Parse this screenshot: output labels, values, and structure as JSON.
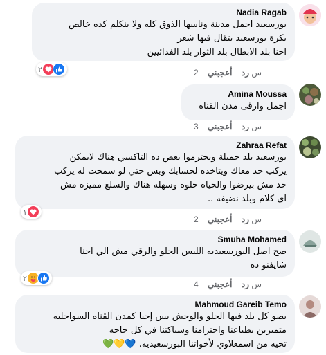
{
  "colors": {
    "bubble": "#f0f2f5",
    "like": "#1877f2",
    "love": "#f33e58",
    "care": "#f7b125",
    "meta": "#65676b"
  },
  "comments": [
    {
      "author": "Nadia Ragab",
      "lines": [
        "بورسعيد اجمل مدينة وناسها الذوق كله ولا بنكلم كده خالص",
        "بكرة بورسعيد يتقال فيها شعر",
        "احنا بلد الابطال بلد الثوار بلد الفدائيين"
      ],
      "like": "أعجبني",
      "reply": "رد",
      "time": "2 س",
      "reaction_count": "٢",
      "reactions": [
        "like-icon",
        "love-icon"
      ]
    },
    {
      "author": "Amina Moussa",
      "lines": [
        "اجمل وارقى مدن القناه"
      ],
      "like": "أعجبني",
      "reply": "رد",
      "time": "3 س"
    },
    {
      "author": "Zahraa Refat",
      "lines": [
        "بورسعيد بلد جميلة ويحترموا بعض ده التاكسي هناك لايمكن",
        "يركب حد معاك ويتاخده لحسابك وبس حتي لو سمحت له يركب",
        "حد مش بيرضوا والحياة حلوة وسهله هناك والسلع مميزة مش",
        "اي كلام وبلد نضيفه .."
      ],
      "like": "أعجبني",
      "reply": "رد",
      "time": "2 س",
      "reaction_count": "١",
      "reactions": [
        "love-icon"
      ]
    },
    {
      "author": "Smuha Mohamed",
      "lines": [
        "صح اصل البورسعيديه اللبس الحلو والرقي مش الي احنا",
        "شايفنو ده"
      ],
      "like": "أعجبني",
      "reply": "رد",
      "time": "4 س",
      "reaction_count": "٢",
      "reactions": [
        "like-icon",
        "care-icon"
      ]
    },
    {
      "author": "Mahmoud Gareib Temo",
      "lines": [
        "بصو كل بلد فيها الحلو والوحش بس إحنا كمدن القناه السواحليه",
        "متميزين بطباعنا واحترامنا وشياكتنا في كل حاجه",
        "تحيه من اسمعلاوي لأخواتنا البورسعيديه، 💙💛💚"
      ]
    }
  ]
}
